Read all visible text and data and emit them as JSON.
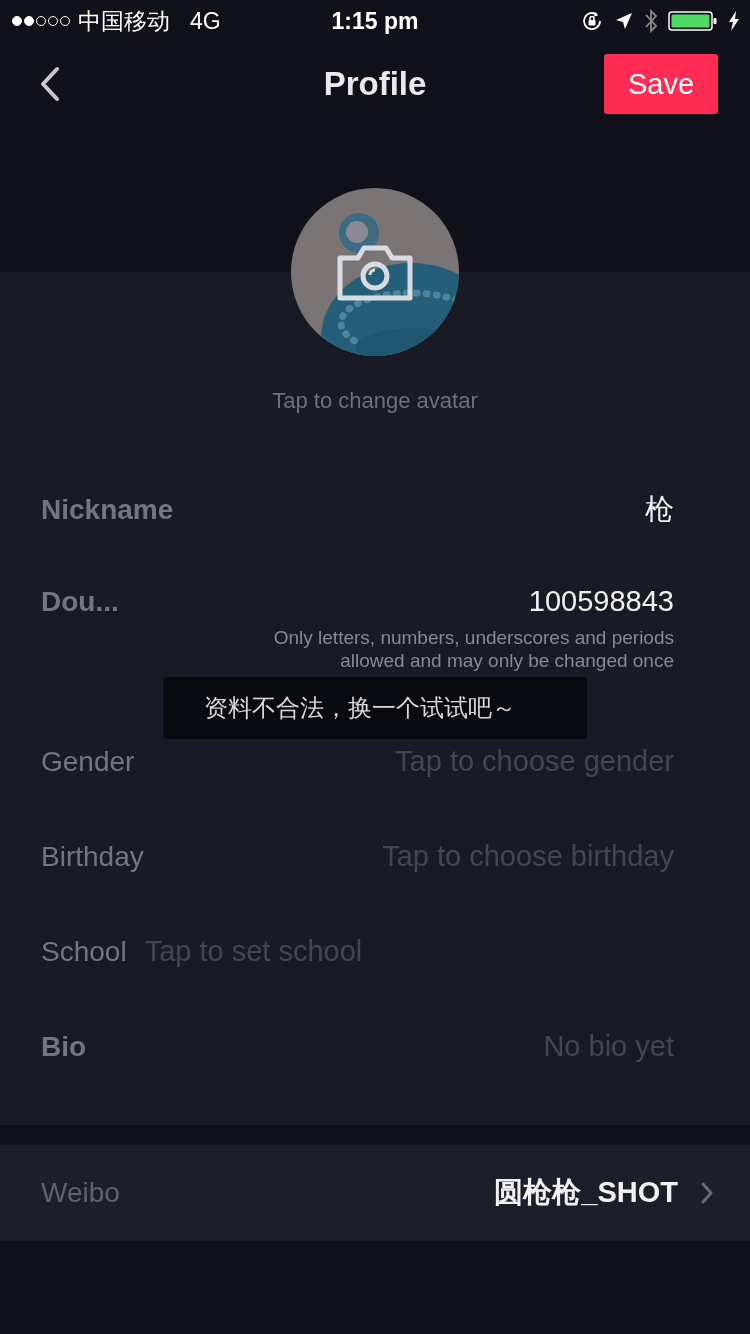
{
  "status_bar": {
    "signal_dots": [
      {
        "on": true
      },
      {
        "on": true
      },
      {
        "on": false
      },
      {
        "on": false
      },
      {
        "on": false
      }
    ],
    "carrier": "中国移动",
    "network": "4G",
    "time": "1:15 pm"
  },
  "nav": {
    "title": "Profile",
    "save": "Save"
  },
  "avatar": {
    "kind": "picture",
    "hint": "Tap to change avatar"
  },
  "fields": [
    {
      "label": "Nickname",
      "emphasized": true,
      "kind": "value",
      "value": "枪"
    },
    {
      "label": "Dou...",
      "emphasized": true,
      "kind": "value",
      "value": "100598843",
      "note": "Only letters, numbers, underscores and periods allowed and may only be changed once"
    },
    {
      "label": "Gender",
      "emphasized": false,
      "kind": "placeholder",
      "placeholder": "Tap to choose gender"
    },
    {
      "label": "Birthday",
      "emphasized": false,
      "kind": "placeholder",
      "placeholder": "Tap to choose birthday"
    },
    {
      "label": "School",
      "emphasized": false,
      "kind": "inline",
      "placeholder": "Tap to set school"
    },
    {
      "label": "Bio",
      "emphasized": true,
      "kind": "placeholder",
      "placeholder": "No bio yet"
    }
  ],
  "weibo": {
    "label": "Weibo",
    "value": "圆枪枪_SHOT"
  },
  "toast": "资料不合法，换一个试试吧～"
}
